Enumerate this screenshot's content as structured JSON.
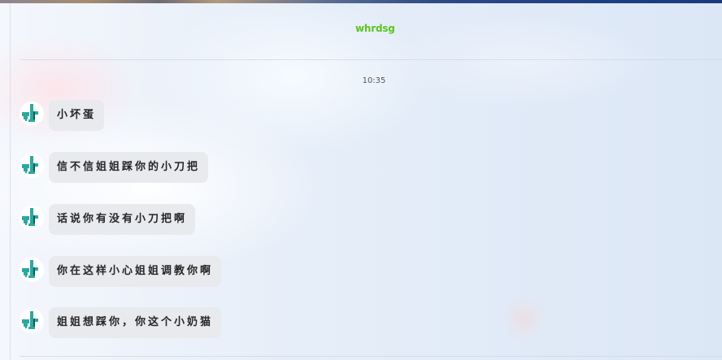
{
  "chat": {
    "title": "whrdsg",
    "title_color": "#5cc421",
    "timestamp": "10:35"
  },
  "messages": [
    {
      "sender": "contact",
      "avatar_icon": "teal-pixel-figure-icon",
      "text": "小坏蛋"
    },
    {
      "sender": "contact",
      "avatar_icon": "teal-pixel-figure-icon",
      "text": "信不信姐姐踩你的小刀把"
    },
    {
      "sender": "contact",
      "avatar_icon": "teal-pixel-figure-icon",
      "text": "话说你有没有小刀把啊"
    },
    {
      "sender": "contact",
      "avatar_icon": "teal-pixel-figure-icon",
      "text": "你在这样小心姐姐调教你啊"
    },
    {
      "sender": "contact",
      "avatar_icon": "teal-pixel-figure-icon",
      "text": "姐姐想踩你，你这个小奶猫"
    }
  ],
  "colors": {
    "bubble": "#e8eaed",
    "avatar_primary": "#2ca8a0",
    "avatar_dark": "#0f5f5a"
  }
}
